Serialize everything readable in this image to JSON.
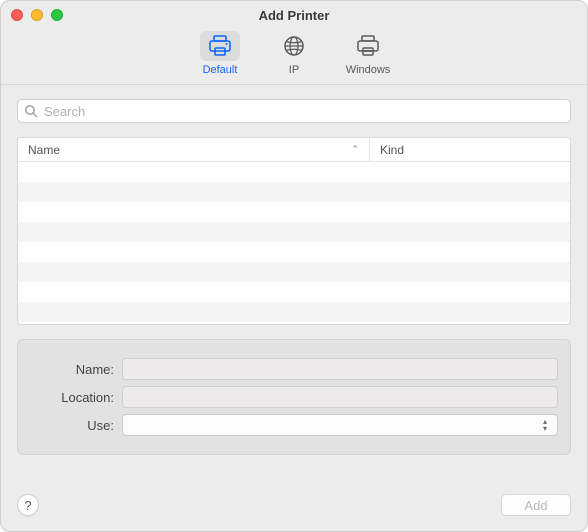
{
  "window": {
    "title": "Add Printer"
  },
  "toolbar": {
    "items": [
      {
        "id": "default",
        "label": "Default",
        "selected": true
      },
      {
        "id": "ip",
        "label": "IP",
        "selected": false
      },
      {
        "id": "windows",
        "label": "Windows",
        "selected": false
      }
    ]
  },
  "search": {
    "placeholder": "Search",
    "value": ""
  },
  "table": {
    "columns": [
      {
        "id": "name",
        "label": "Name",
        "sorted": "asc"
      },
      {
        "id": "kind",
        "label": "Kind"
      }
    ],
    "rows": []
  },
  "form": {
    "name": {
      "label": "Name:",
      "value": ""
    },
    "location": {
      "label": "Location:",
      "value": ""
    },
    "use": {
      "label": "Use:",
      "value": ""
    }
  },
  "footer": {
    "help_tooltip": "Help",
    "add_label": "Add",
    "add_enabled": false
  },
  "colors": {
    "accent": "#0a66ff",
    "window_bg": "#ececec"
  }
}
